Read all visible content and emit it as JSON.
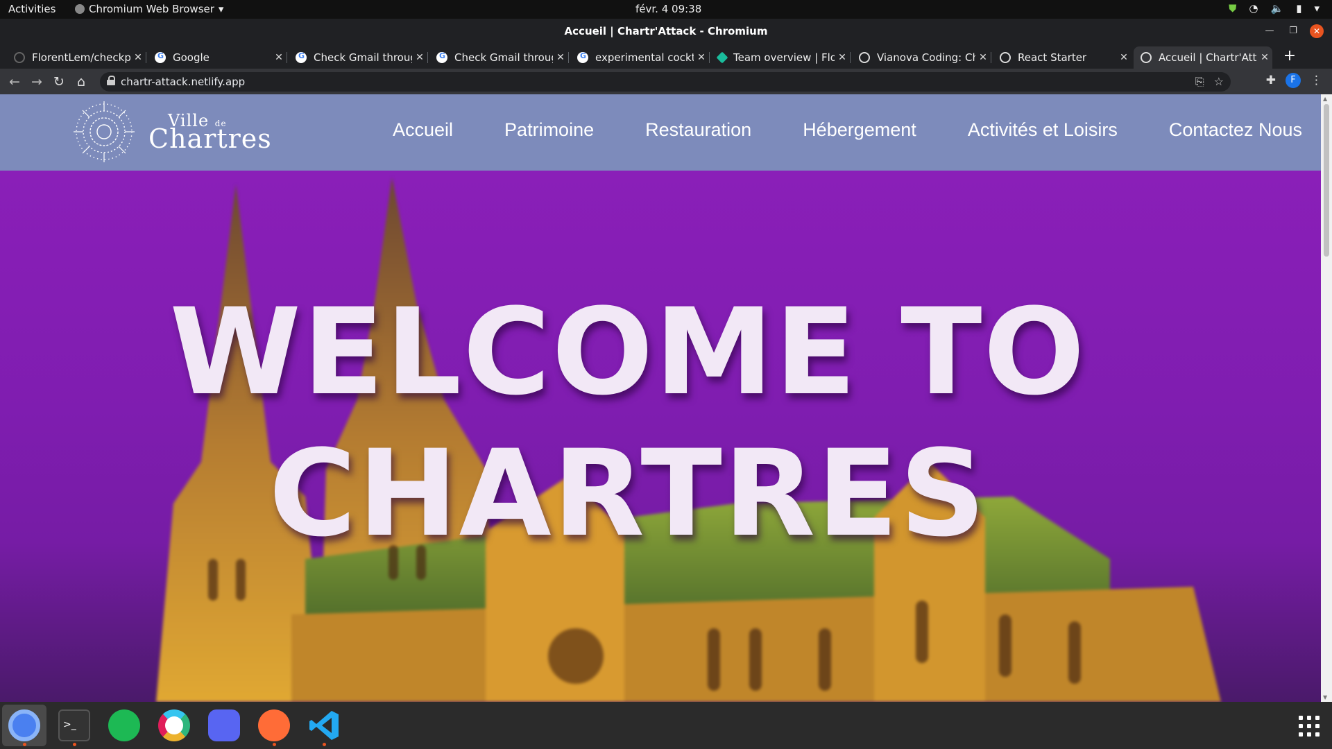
{
  "system_bar": {
    "activities": "Activities",
    "app_name": "Chromium Web Browser",
    "clock": "févr. 4  09:38"
  },
  "window": {
    "title": "Accueil | Chartr'Attack - Chromium"
  },
  "tabs": [
    {
      "label": "FlorentLem/checkpoint",
      "icon": "github-icon"
    },
    {
      "label": "Google",
      "icon": "google-icon"
    },
    {
      "label": "Check Gmail through",
      "icon": "google-icon"
    },
    {
      "label": "Check Gmail through",
      "icon": "google-icon"
    },
    {
      "label": "experimental cocktail",
      "icon": "google-icon"
    },
    {
      "label": "Team overview | Flor",
      "icon": "team-icon"
    },
    {
      "label": "Vianova Coding: Cha",
      "icon": "globe-icon"
    },
    {
      "label": "React Starter",
      "icon": "globe-icon"
    },
    {
      "label": "Accueil | Chartr'Attack",
      "icon": "globe-icon"
    }
  ],
  "new_tab_label": "+",
  "address_bar": {
    "url": "chartr-attack.netlify.app"
  },
  "toolbar": {
    "profile_initial": "F"
  },
  "site": {
    "logo": {
      "line1": "Ville",
      "line1_suffix": "de",
      "line2": "Chartres"
    },
    "menu": [
      "Accueil",
      "Patrimoine",
      "Restauration",
      "Hébergement",
      "Activités et Loisirs",
      "Contactez Nous"
    ],
    "hero": {
      "line1": "WELCOME TO",
      "line2": "CHARTRES"
    }
  },
  "dock": [
    "chromium-icon",
    "terminal-icon",
    "spotify-icon",
    "slack-icon",
    "discord-icon",
    "postman-icon",
    "vscode-icon"
  ],
  "colors": {
    "nav_bg": "#7d8bbb",
    "hero_purple": "#8a1fb8",
    "ubuntu_orange": "#e95420"
  }
}
